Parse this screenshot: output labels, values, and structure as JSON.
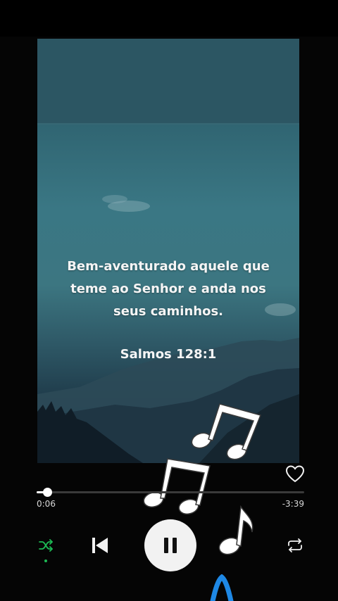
{
  "artwork": {
    "quote_lines": [
      "Bem-aventurado aquele que",
      "teme ao Senhor e anda nos",
      "seus caminhos."
    ],
    "reference": "Salmos 128:1"
  },
  "player": {
    "progress": {
      "elapsed": "0:06",
      "remaining": "-3:39",
      "fraction": 0.04
    },
    "liked": false,
    "shuffle_active": true,
    "state": "playing"
  },
  "icons": {
    "like": "heart-outline-icon",
    "shuffle": "shuffle-icon",
    "previous": "skip-previous-icon",
    "pause": "pause-icon",
    "repeat": "repeat-icon",
    "decoration": "music-note-icon"
  },
  "colors": {
    "accent": "#1db954",
    "shuffle_active": "#1db954",
    "background": "#050505",
    "pause_button": "#f2f2f2",
    "edge_highlight": "#1e88e5"
  }
}
